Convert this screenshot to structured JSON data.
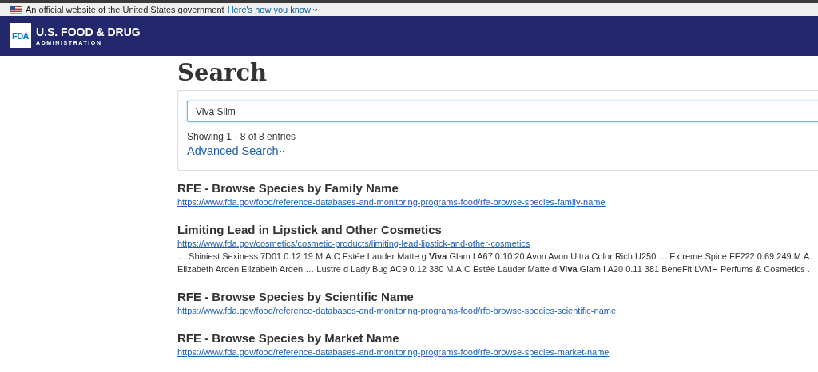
{
  "gov_banner": {
    "text": "An official website of the United States government",
    "link": "Here's how you know"
  },
  "header": {
    "logo": "FDA",
    "title": "U.S. FOOD & DRUG",
    "subtitle": "ADMINISTRATION"
  },
  "page_title": "Search",
  "search": {
    "value": "Viva Slim",
    "summary": "Showing 1 - 8 of 8 entries",
    "advanced_link": "Advanced Search"
  },
  "results": [
    {
      "title": "RFE - Browse Species by Family Name",
      "url": "https://www.fda.gov/food/reference-databases-and-monitoring-programs-food/rfe-browse-species-family-name"
    },
    {
      "title": "Limiting Lead in Lipstick and Other Cosmetics",
      "url": "https://www.fda.gov/cosmetics/cosmetic-products/limiting-lead-lipstick-and-other-cosmetics",
      "snippet": [
        "… Shiniest Sexiness 7D01 0.12 19 M.A.C Estée Lauder Matte g **Viva** Glam I A67 0.10 20 Avon Avon Ultra Color Rich U250 … Extreme Spice FF222 0.69 249 M.A.",
        "Elizabeth Arden Elizabeth Arden … Lustre d Lady Bug AC9 0.12 380 M.A.C Estée Lauder Matte d **Viva** Glam I A20 0.11 381 BeneFit LVMH Perfums & Cosmetics ."
      ]
    },
    {
      "title": "RFE - Browse Species by Scientific Name",
      "url": "https://www.fda.gov/food/reference-databases-and-monitoring-programs-food/rfe-browse-species-scientific-name"
    },
    {
      "title": "RFE - Browse Species by Market Name",
      "url": "https://www.fda.gov/food/reference-databases-and-monitoring-programs-food/rfe-browse-species-market-name"
    }
  ]
}
